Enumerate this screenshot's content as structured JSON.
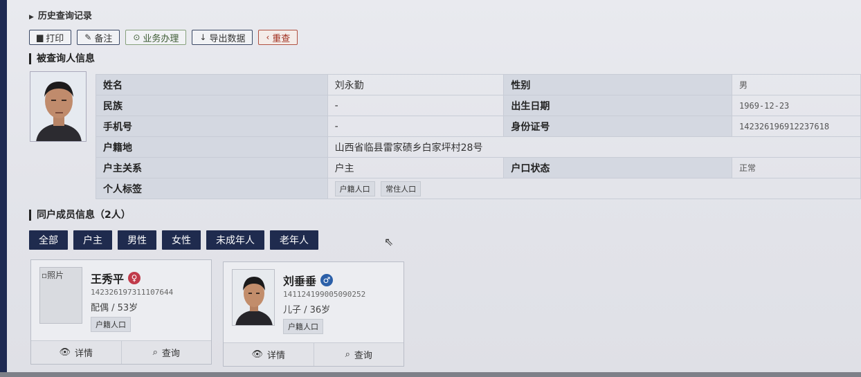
{
  "history": {
    "label": "历史查询记录"
  },
  "toolbar": {
    "print": "打印",
    "note": "备注",
    "business": "业务办理",
    "export": "导出数据",
    "requery": "重查"
  },
  "section_person": "被查询人信息",
  "person": {
    "name_label": "姓名",
    "name": "刘永勤",
    "gender_label": "性别",
    "gender": "男",
    "ethnic_label": "民族",
    "ethnic": "-",
    "birth_label": "出生日期",
    "birth": "1969-12-23",
    "phone_label": "手机号",
    "phone": "-",
    "id_label": "身份证号",
    "id": "142326196912237618",
    "address_label": "户籍地",
    "address": "山西省临县雷家碛乡白家坪村28号",
    "relation_label": "户主关系",
    "relation": "户主",
    "status_label": "户口状态",
    "status": "正常",
    "tags_label": "个人标签",
    "tags": [
      "户籍人口",
      "常住人口"
    ]
  },
  "section_household": "同户成员信息（2人）",
  "filters": [
    "全部",
    "户主",
    "男性",
    "女性",
    "未成年人",
    "老年人"
  ],
  "members": [
    {
      "photo_alt": "照片",
      "name": "王秀平",
      "gender_icon": "female-icon",
      "id": "142326197311107644",
      "rel": "配偶 / 53岁",
      "tag": "户籍人口",
      "detail": "详情",
      "query": "查询"
    },
    {
      "name": "刘垂垂",
      "gender_icon": "male-icon",
      "id": "141124199005090252",
      "rel": "儿子 / 36岁",
      "tag": "户籍人口",
      "detail": "详情",
      "query": "查询"
    }
  ],
  "colors": {
    "nav_dark": "#1f2b4e",
    "female": "#c03a4a",
    "male": "#2b5fa8",
    "requery": "#a02e1e"
  }
}
